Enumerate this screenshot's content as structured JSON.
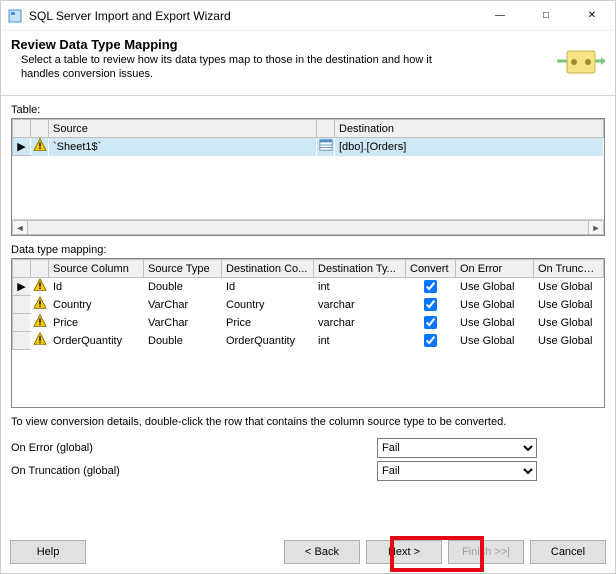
{
  "window": {
    "title": "SQL Server Import and Export Wizard"
  },
  "header": {
    "title": "Review Data Type Mapping",
    "subtitle": "Select a table to review how its data types map to those in the destination and how it handles conversion issues."
  },
  "table_label": "Table:",
  "table_grid": {
    "columns": {
      "source": "Source",
      "destination": "Destination"
    },
    "rows": [
      {
        "source": "`Sheet1$`",
        "destination": "[dbo].[Orders]",
        "warning": true
      }
    ]
  },
  "mapping_label": "Data type mapping:",
  "mapping_grid": {
    "columns": {
      "source_col": "Source Column",
      "source_type": "Source Type",
      "dest_col": "Destination Co...",
      "dest_type": "Destination Ty...",
      "convert": "Convert",
      "on_error": "On Error",
      "on_trunc": "On Truncati..."
    },
    "rows": [
      {
        "warn": true,
        "src_col": "Id",
        "src_type": "Double",
        "dst_col": "Id",
        "dst_type": "int",
        "convert": true,
        "on_error": "Use Global",
        "on_trunc": "Use Global"
      },
      {
        "warn": true,
        "src_col": "Country",
        "src_type": "VarChar",
        "dst_col": "Country",
        "dst_type": "varchar",
        "convert": true,
        "on_error": "Use Global",
        "on_trunc": "Use Global"
      },
      {
        "warn": true,
        "src_col": "Price",
        "src_type": "VarChar",
        "dst_col": "Price",
        "dst_type": "varchar",
        "convert": true,
        "on_error": "Use Global",
        "on_trunc": "Use Global"
      },
      {
        "warn": true,
        "src_col": "OrderQuantity",
        "src_type": "Double",
        "dst_col": "OrderQuantity",
        "dst_type": "int",
        "convert": true,
        "on_error": "Use Global",
        "on_trunc": "Use Global"
      }
    ]
  },
  "info_text": "To view conversion details, double-click the row that contains the column source type to be converted.",
  "globals": {
    "on_error_label": "On Error (global)",
    "on_trunc_label": "On Truncation (global)",
    "on_error_value": "Fail",
    "on_trunc_value": "Fail"
  },
  "buttons": {
    "help": "Help",
    "back": "< Back",
    "next": "Next >",
    "finish": "Finish >>|",
    "cancel": "Cancel"
  }
}
